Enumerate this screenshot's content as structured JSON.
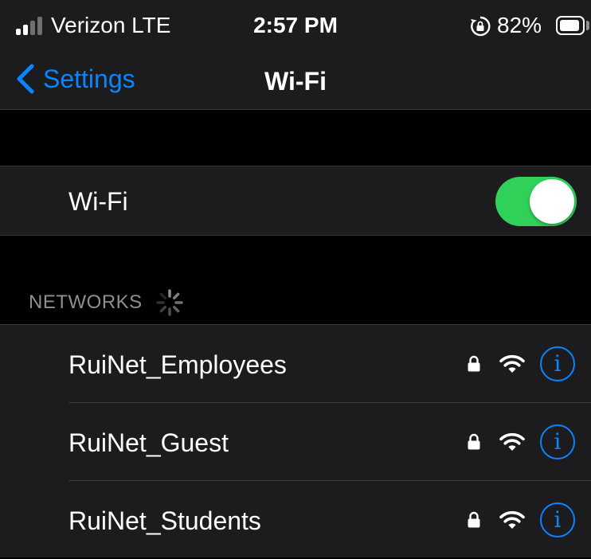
{
  "status_bar": {
    "carrier": "Verizon  LTE",
    "time": "2:57 PM",
    "battery_percent": "82%",
    "battery_level": 0.82,
    "signal_strength": 2,
    "icons": [
      "signal-icon",
      "orientation-lock-icon",
      "battery-icon"
    ]
  },
  "nav": {
    "back_label": "Settings",
    "title": "Wi-Fi",
    "accent_color": "#0a84ff"
  },
  "wifi_toggle": {
    "label": "Wi-Fi",
    "on": true,
    "on_color": "#30d158"
  },
  "networks_section": {
    "header": "NETWORKS",
    "loading": true
  },
  "networks": [
    {
      "name": "RuiNet_Employees",
      "secured": true,
      "icons": [
        "lock-icon",
        "wifi-icon",
        "info-icon"
      ]
    },
    {
      "name": "RuiNet_Guest",
      "secured": true,
      "icons": [
        "lock-icon",
        "wifi-icon",
        "info-icon"
      ]
    },
    {
      "name": "RuiNet_Students",
      "secured": true,
      "icons": [
        "lock-icon",
        "wifi-icon",
        "info-icon"
      ]
    }
  ],
  "info_glyph": "i"
}
